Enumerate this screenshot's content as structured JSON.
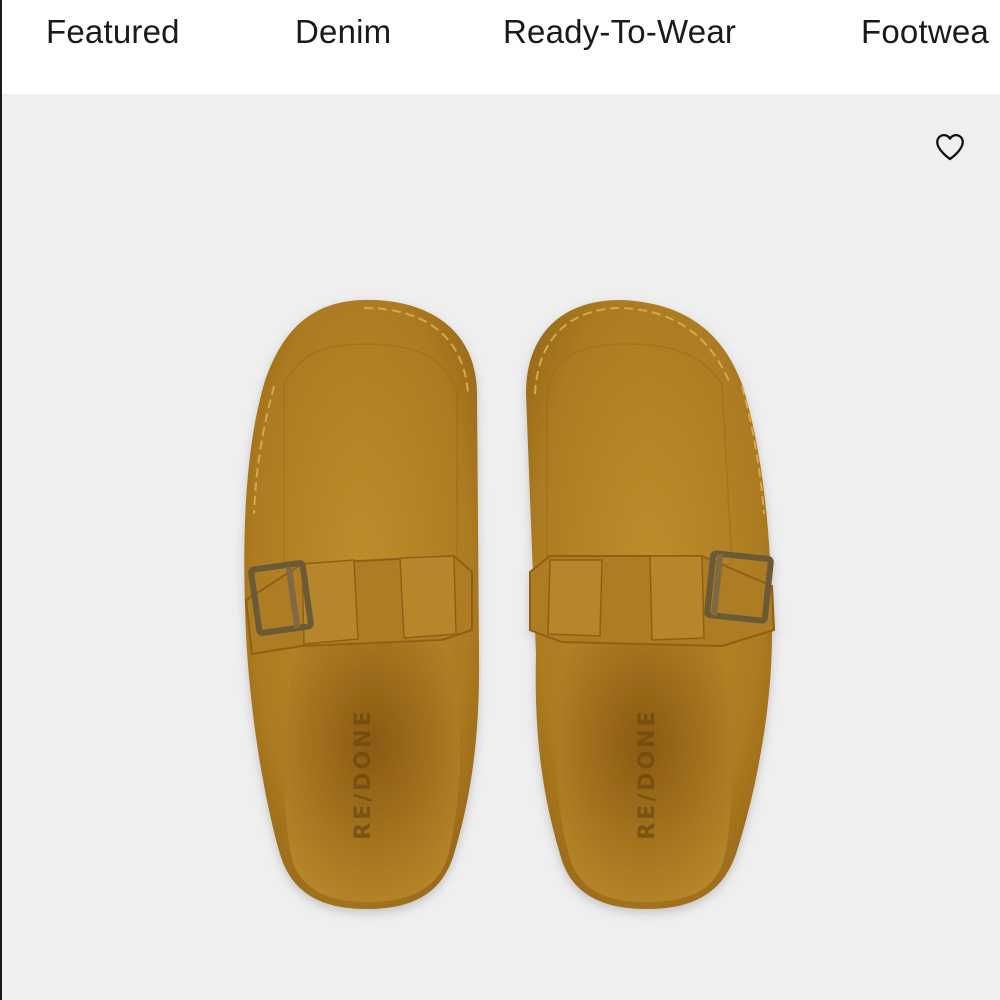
{
  "nav": {
    "items": [
      {
        "label": "Featured"
      },
      {
        "label": "Denim"
      },
      {
        "label": "Ready-To-Wear"
      },
      {
        "label": "Footwea"
      }
    ]
  },
  "product": {
    "wishlist_icon": "heart-outline-icon",
    "image_brand_mark": "RE/DONE",
    "colors": {
      "background": "#efefef",
      "suede": "#b07f22",
      "suede_dark": "#8f6316",
      "buckle": "#6b5a36"
    }
  }
}
